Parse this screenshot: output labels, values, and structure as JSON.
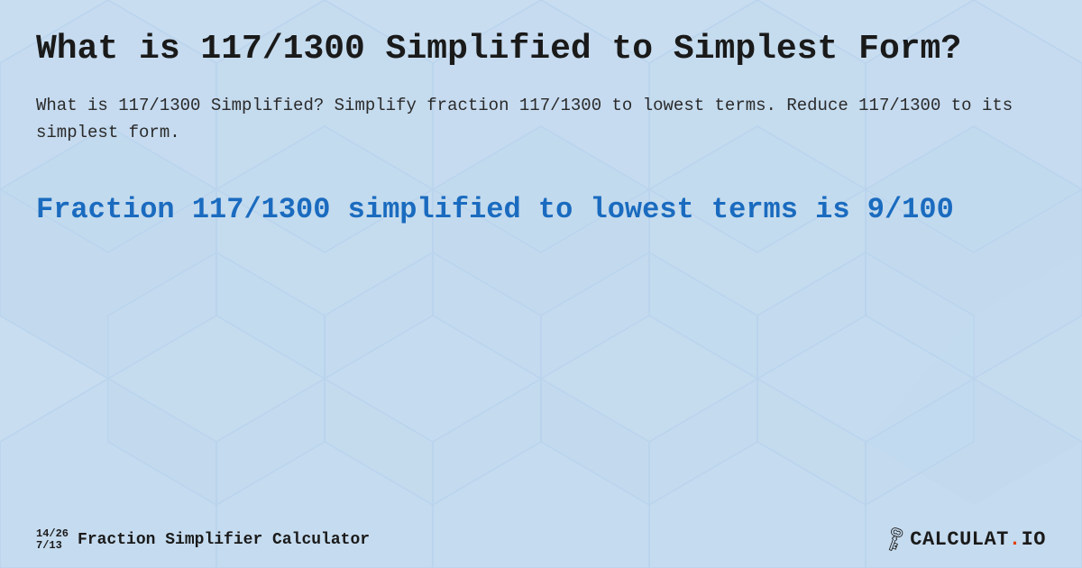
{
  "background": {
    "color": "#c8dff0"
  },
  "title": "What is 117/1300 Simplified to Simplest Form?",
  "description": "What is 117/1300 Simplified? Simplify fraction 117/1300 to lowest terms. Reduce 117/1300 to its simplest form.",
  "result": "Fraction 117/1300 simplified to lowest terms is 9/100",
  "footer": {
    "fraction_top": "14/26",
    "fraction_bottom": "7/13",
    "brand": "Fraction Simplifier Calculator",
    "logo_text_before_dot": "CALCULAT",
    "logo_dot": ".",
    "logo_text_after_dot": "IO"
  }
}
